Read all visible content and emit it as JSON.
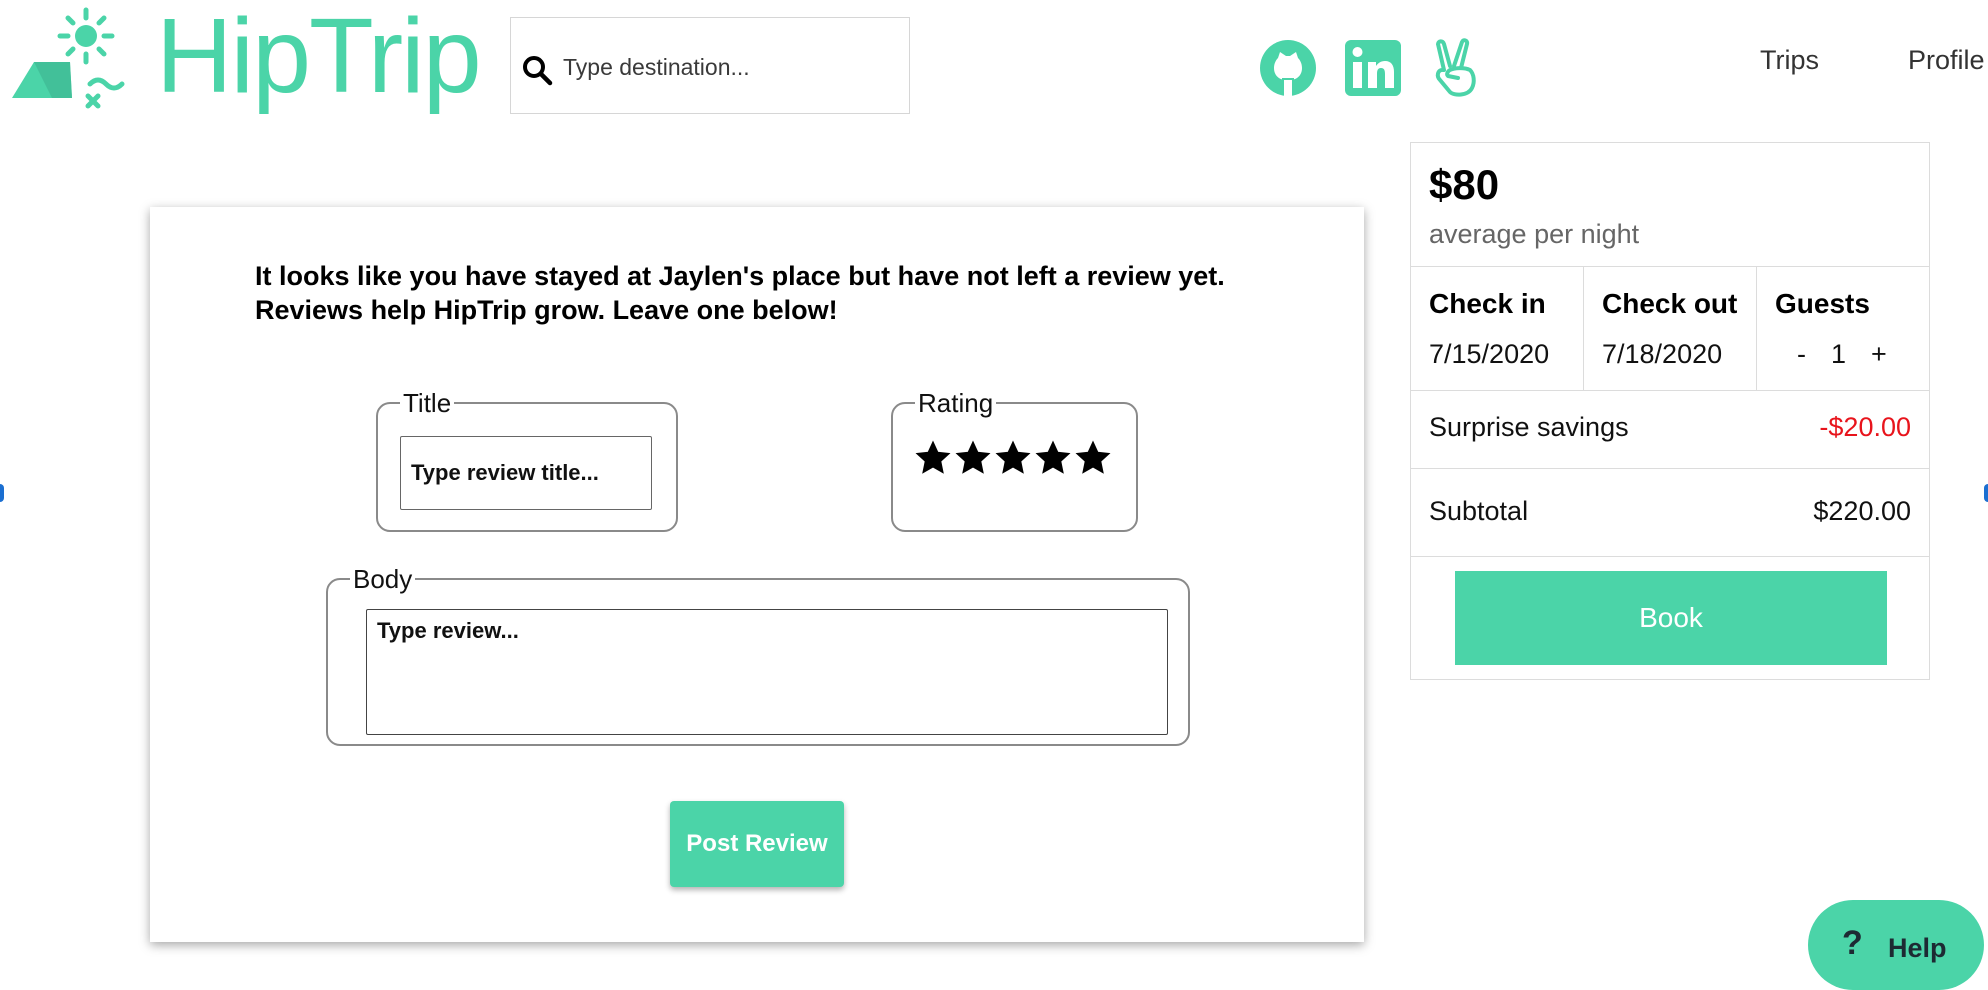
{
  "header": {
    "logo_text": "HipTrip",
    "search_placeholder": "Type destination...",
    "social": [
      {
        "icon": "github-icon"
      },
      {
        "icon": "linkedin-icon"
      },
      {
        "icon": "angellist-icon"
      }
    ],
    "nav": {
      "trips": "Trips",
      "profile": "Profile"
    }
  },
  "review": {
    "intro_line1": "It looks like you have stayed at Jaylen's place but have not left a review yet.",
    "intro_line2": "Reviews help HipTrip grow. Leave one below!",
    "title_legend": "Title",
    "title_placeholder": "Type review title...",
    "rating_legend": "Rating",
    "rating_value": 5,
    "rating_max": 5,
    "body_legend": "Body",
    "body_placeholder": "Type review...",
    "post_label": "Post Review"
  },
  "booking": {
    "price": "$80",
    "price_sub": "average per night",
    "check_in_label": "Check in",
    "check_in_value": "7/15/2020",
    "check_out_label": "Check out",
    "check_out_value": "7/18/2020",
    "guests_label": "Guests",
    "guests_minus": "-",
    "guests_value": "1",
    "guests_plus": "+",
    "savings_label": "Surprise savings",
    "savings_value": "-$20.00",
    "subtotal_label": "Subtotal",
    "subtotal_value": "$220.00",
    "book_label": "Book"
  },
  "help": {
    "icon": "question-icon",
    "q": "?",
    "label": "Help"
  },
  "colors": {
    "brand": "#4bd4a8",
    "savings": "#e8141c"
  }
}
